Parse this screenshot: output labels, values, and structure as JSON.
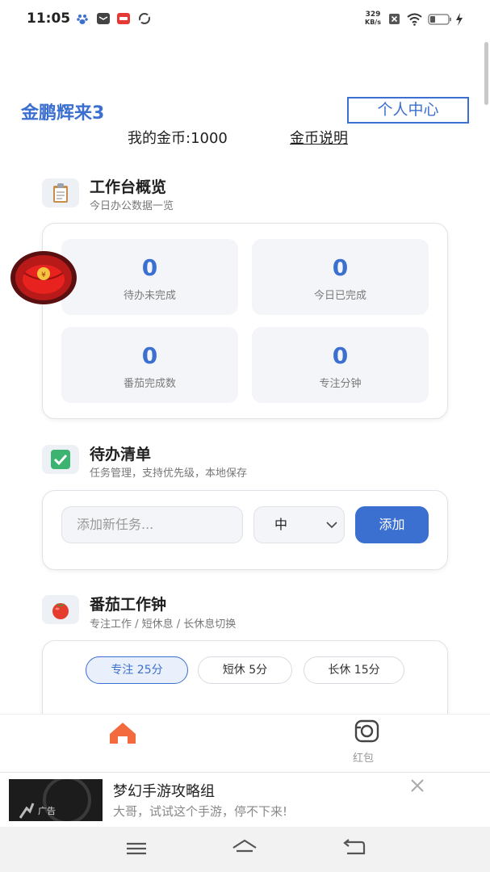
{
  "status_bar": {
    "time": "11:05",
    "net_speed_value": "329",
    "net_speed_unit": "KB/s"
  },
  "header": {
    "app_title": "金鹏辉来3",
    "profile_button": "个人中心",
    "coins": "我的金币:1000",
    "coins_link": "金币说明"
  },
  "overview": {
    "icon": "clipboard-icon",
    "title": "工作台概览",
    "subtitle": "今日办公数据一览",
    "stats": [
      {
        "value": "0",
        "label": "待办未完成"
      },
      {
        "value": "0",
        "label": "今日已完成"
      },
      {
        "value": "0",
        "label": "番茄完成数"
      },
      {
        "value": "0",
        "label": "专注分钟"
      }
    ]
  },
  "todo": {
    "icon": "checkmark-icon",
    "title": "待办清单",
    "subtitle": "任务管理，支持优先级，本地保存",
    "input_placeholder": "添加新任务...",
    "priority_selected": "中",
    "add_button": "添加"
  },
  "pomodoro": {
    "icon": "tomato-icon",
    "title": "番茄工作钟",
    "subtitle": "专注工作 / 短休息 / 长休息切换",
    "modes": [
      "专注 25分",
      "短休 5分",
      "长休 15分"
    ],
    "active_mode": 0
  },
  "floating_badge": {
    "symbol": "¥"
  },
  "bottom_nav": {
    "items": [
      {
        "icon": "home-icon",
        "label": ""
      },
      {
        "icon": "camera-icon",
        "label": "红包"
      }
    ]
  },
  "ad": {
    "badge": "广告",
    "title": "梦幻手游攻略组",
    "description": "大哥，试试这个手游，停不下来!"
  },
  "colors": {
    "accent": "#3b6fd0",
    "home_icon": "#f26a3d",
    "card_bg": "#f3f5f8"
  }
}
